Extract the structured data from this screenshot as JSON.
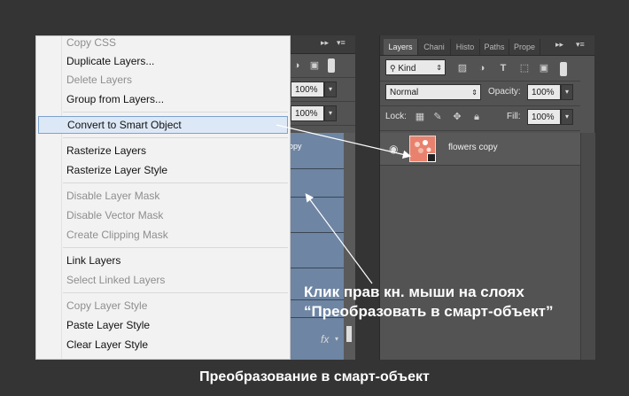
{
  "context_menu": {
    "items": [
      {
        "label": "Copy CSS",
        "disabled": true
      },
      {
        "label": "Duplicate Layers...",
        "disabled": false
      },
      {
        "label": "Delete Layers",
        "disabled": true
      },
      {
        "label": "Group from Layers...",
        "disabled": false
      },
      {
        "label": "Convert to Smart Object",
        "disabled": false,
        "highlighted": true
      },
      {
        "label": "Rasterize Layers",
        "disabled": false
      },
      {
        "label": "Rasterize Layer Style",
        "disabled": false
      },
      {
        "label": "Disable Layer Mask",
        "disabled": true
      },
      {
        "label": "Disable Vector Mask",
        "disabled": true
      },
      {
        "label": "Create Clipping Mask",
        "disabled": true
      },
      {
        "label": "Link Layers",
        "disabled": false
      },
      {
        "label": "Select Linked Layers",
        "disabled": true
      },
      {
        "label": "Copy Layer Style",
        "disabled": true
      },
      {
        "label": "Paste Layer Style",
        "disabled": false
      },
      {
        "label": "Clear Layer Style",
        "disabled": false
      }
    ]
  },
  "left_panel": {
    "opacity_value": "100%",
    "fill_value": "100%",
    "layer_name_partial": "opy",
    "fx_label": "fx"
  },
  "layers_panel": {
    "tabs": [
      "Layers",
      "Chani",
      "Histo",
      "Paths",
      "Prope"
    ],
    "kind_label": "Kind",
    "blend_mode": "Normal",
    "opacity_label": "Opacity:",
    "opacity_value": "100%",
    "lock_label": "Lock:",
    "fill_label": "Fill:",
    "fill_value": "100%",
    "layer_name": "flowers copy"
  },
  "annotation": {
    "line1": "Клик прав кн. мыши на слоях",
    "line2": "“Преобразовать в смарт-объект”"
  },
  "caption": "Преобразование в смарт-объект",
  "colors": {
    "background": "#343434",
    "panel": "#535353",
    "menu_highlight": "#dce8f6",
    "layers_blue": "#6e85a3"
  }
}
